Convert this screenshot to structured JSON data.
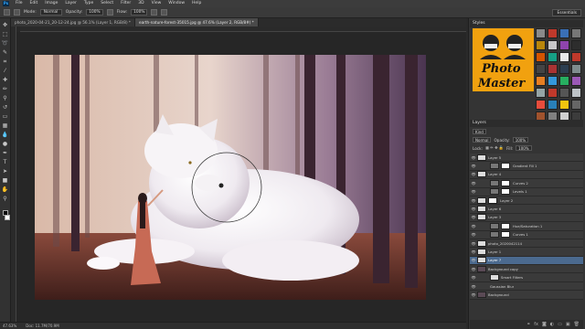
{
  "menubar": {
    "logo": "Ps",
    "items": [
      "File",
      "Edit",
      "Image",
      "Layer",
      "Type",
      "Select",
      "Filter",
      "3D",
      "View",
      "Window",
      "Help"
    ]
  },
  "options": {
    "mode_label": "Mode:",
    "mode_value": "Normal",
    "opacity_label": "Opacity:",
    "opacity_value": "100%",
    "flow_label": "Flow:",
    "flow_value": "100%",
    "workspace": "Essentials"
  },
  "tabs": [
    {
      "label": "photo_2020-04-21_20-12-24.jpg @ 56.1% (Layer 1, RGB/8) *",
      "active": false
    },
    {
      "label": "earth-nature-forest-35015.jpg @ 47.6% (Layer 2, RGB/8#) *",
      "active": true
    }
  ],
  "statusbar": {
    "zoom": "47.63%",
    "doc": "Doc: 11.7M/70.9M"
  },
  "styles_panel": {
    "title": "Styles",
    "logo_line1": "Photo",
    "logo_line2": "Master",
    "swatch_colors": [
      "#8a8a8a",
      "#c0392b",
      "#3a6fb5",
      "#777",
      "#b8860b",
      "#c8c8c8",
      "#8e44ad",
      "#2d2d2d",
      "#d35400",
      "#16a085",
      "#e8e8e8",
      "#c0392b",
      "#444",
      "#aa3333",
      "#2c3e50",
      "#7f8c8d",
      "#e67e22",
      "#3498db",
      "#27ae60",
      "#9b59b6",
      "#95a5a6",
      "#c0392b",
      "#555",
      "#bdc3c7",
      "#e74c3c",
      "#2980b9",
      "#f1c40f",
      "#666",
      "#a0522d",
      "#808080",
      "#d0d0d0",
      "#3c3c3c"
    ]
  },
  "layers_panel": {
    "title": "Layers",
    "kind": "Kind",
    "blend": "Normal",
    "opacity_label": "Opacity:",
    "opacity_value": "100%",
    "lock_label": "Lock:",
    "fill_label": "Fill:",
    "fill_value": "100%",
    "layers": [
      {
        "name": "Layer 5",
        "thumb": "light",
        "mask": false,
        "indent": false,
        "selected": false
      },
      {
        "name": "Gradient Fill 1",
        "thumb": "adj",
        "mask": true,
        "indent": true,
        "selected": false
      },
      {
        "name": "Layer 4",
        "thumb": "light",
        "mask": false,
        "indent": false,
        "selected": false
      },
      {
        "name": "Curves 2",
        "thumb": "adj",
        "mask": true,
        "indent": true,
        "selected": false
      },
      {
        "name": "Levels 1",
        "thumb": "adj",
        "mask": true,
        "indent": true,
        "selected": false
      },
      {
        "name": "Layer 2",
        "thumb": "light",
        "mask": true,
        "indent": false,
        "selected": false
      },
      {
        "name": "Layer 6",
        "thumb": "light",
        "mask": false,
        "indent": false,
        "selected": false
      },
      {
        "name": "Layer 3",
        "thumb": "light",
        "mask": false,
        "indent": false,
        "selected": false
      },
      {
        "name": "Hue/Saturation 1",
        "thumb": "adj",
        "mask": true,
        "indent": true,
        "selected": false
      },
      {
        "name": "Curves 1",
        "thumb": "adj",
        "mask": true,
        "indent": true,
        "selected": false
      },
      {
        "name": "photo_2020042114",
        "thumb": "light",
        "mask": false,
        "indent": false,
        "selected": false
      },
      {
        "name": "Layer 1",
        "thumb": "light",
        "mask": false,
        "indent": false,
        "selected": false
      },
      {
        "name": "Layer 7",
        "thumb": "light",
        "mask": false,
        "indent": false,
        "selected": true
      },
      {
        "name": "Background copy",
        "thumb": "dark",
        "mask": false,
        "indent": false,
        "selected": false
      },
      {
        "name": "Smart Filters",
        "thumb": "light",
        "mask": false,
        "indent": true,
        "selected": false
      },
      {
        "name": "Gaussian Blur",
        "thumb": "none",
        "mask": false,
        "indent": true,
        "selected": false
      },
      {
        "name": "Background",
        "thumb": "dark",
        "mask": false,
        "indent": false,
        "selected": false
      }
    ]
  },
  "colors": {
    "ui_dark": "#282828",
    "panel": "#343434",
    "selection": "#4b6a8f",
    "logo_bg": "#f1a10f"
  }
}
